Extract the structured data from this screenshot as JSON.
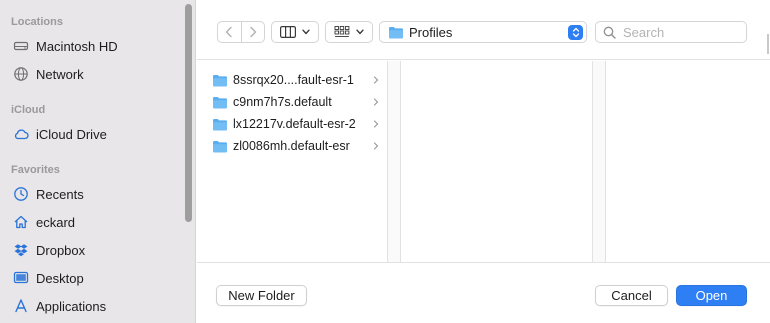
{
  "sidebar": {
    "sections": [
      {
        "title": "Locations",
        "items": [
          {
            "label": "Macintosh HD",
            "icon": "internal-drive-icon"
          },
          {
            "label": "Network",
            "icon": "network-globe-icon"
          }
        ]
      },
      {
        "title": "iCloud",
        "items": [
          {
            "label": "iCloud Drive",
            "icon": "cloud-icon"
          }
        ]
      },
      {
        "title": "Favorites",
        "items": [
          {
            "label": "Recents",
            "icon": "clock-icon"
          },
          {
            "label": "eckard",
            "icon": "house-icon"
          },
          {
            "label": "Dropbox",
            "icon": "dropbox-icon"
          },
          {
            "label": "Desktop",
            "icon": "desktop-icon"
          },
          {
            "label": "Applications",
            "icon": "applications-icon"
          }
        ]
      }
    ]
  },
  "toolbar": {
    "current_folder": "Profiles",
    "search_placeholder": "Search",
    "search_value": ""
  },
  "browser": {
    "column1": [
      {
        "name": "8ssrqx20....fault-esr-1"
      },
      {
        "name": "c9nm7h7s.default"
      },
      {
        "name": "lx12217v.default-esr-2"
      },
      {
        "name": "zl0086mh.default-esr"
      }
    ]
  },
  "footer": {
    "new_folder_label": "New Folder",
    "cancel_label": "Cancel",
    "open_label": "Open"
  },
  "colors": {
    "accent": "#2f7ff4",
    "icon_blue": "#2a73d9",
    "folder_blue": "#5aaef0",
    "sidebar_bg": "#e8e6e8"
  }
}
